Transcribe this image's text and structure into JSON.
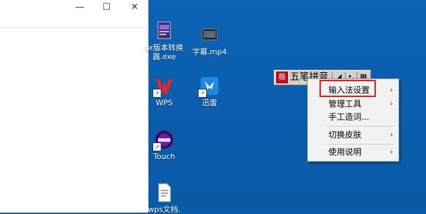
{
  "window": {
    "controls": {
      "minimize": "—",
      "maximize": "☐",
      "close": "✕"
    }
  },
  "desktop": {
    "icons": [
      {
        "label_line1": "pr版本转换",
        "label_line2": "器.exe",
        "icon": "converter-exe-icon"
      },
      {
        "label_line1": "字幕.mp4",
        "label_line2": "",
        "icon": "video-file-icon"
      },
      {
        "label_line1": "WPS",
        "label_line2": "",
        "icon": "wps-icon"
      },
      {
        "label_line1": "迅雷",
        "label_line2": "",
        "icon": "xunlei-icon"
      },
      {
        "label_line1": "Touch",
        "label_line2": "",
        "icon": "touch-icon"
      },
      {
        "label_line1": "wps文档.",
        "label_line2": "",
        "icon": "document-icon"
      }
    ]
  },
  "ime_toolbar": {
    "logo_text": "极",
    "name": "五笔拼音",
    "mode_glyph": "◢",
    "punct_glyph": "•,",
    "keyboard_glyph": "▦"
  },
  "context_menu": {
    "items": [
      {
        "label": "输入法设置",
        "has_submenu": true
      },
      {
        "label": "管理工具",
        "has_submenu": true
      },
      {
        "label": "手工造词...",
        "has_submenu": false
      },
      {
        "label": "切换皮肤",
        "has_submenu": true
      },
      {
        "label": "使用说明",
        "has_submenu": true
      }
    ],
    "arrow": "›"
  }
}
